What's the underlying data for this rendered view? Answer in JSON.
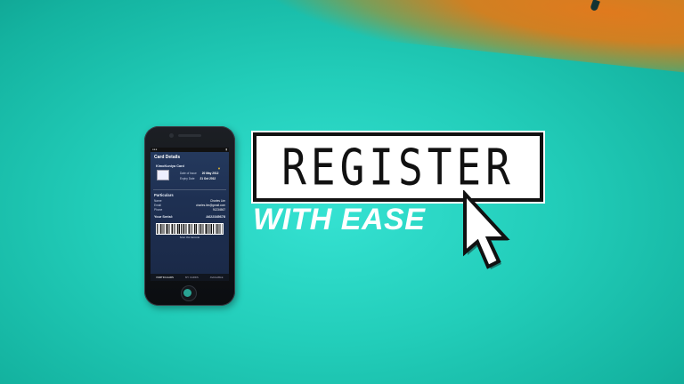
{
  "phone": {
    "screen_title": "Card Details",
    "card_name": "KimoKuniya Card",
    "date_issue_label": "Date of Issue",
    "date_issue": "20 May 2012",
    "expiry_label": "Expiry Date",
    "expiry": "21 Oct 2012",
    "section_title": "Particulars",
    "rows": [
      {
        "label": "Name",
        "value": "Charles Lim"
      },
      {
        "label": "Email",
        "value": "charles.lim@gmail.com"
      },
      {
        "label": "Phone",
        "value": "91234567"
      }
    ],
    "serial_label": "Your Serial:",
    "serial_value": "A622345678",
    "barcode_caption": "Scan this barcode",
    "tabs": [
      "PARTICULARS",
      "MY CARDS",
      "AVAILABLE"
    ]
  },
  "headline": {
    "register": "REGISTER",
    "tagline": "WITH EASE"
  },
  "colors": {
    "background": "#22cdb9",
    "accent_orange": "#e07a1e",
    "box_border": "#111111",
    "text_white": "#ffffff"
  },
  "icons": {
    "cursor": "mouse-pointer-arrow-icon",
    "badge": "verified-badge-icon"
  }
}
